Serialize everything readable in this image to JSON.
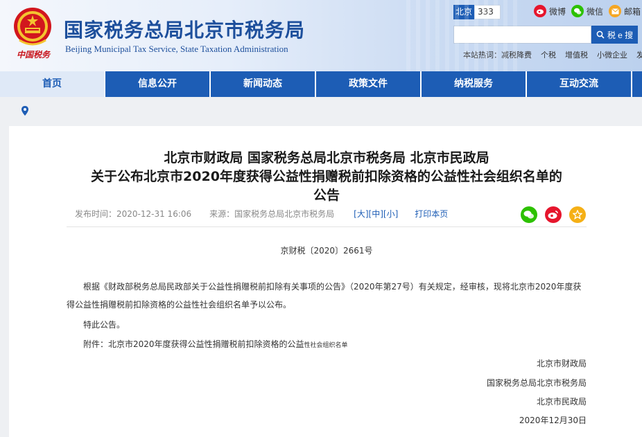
{
  "header": {
    "emblem_caption": "中国税务",
    "title": "国家税务总局北京市税务局",
    "subtitle": "Beijing Municipal Tax Service, State Taxation Administration",
    "city_label": "北京",
    "city_code": "333",
    "social": [
      {
        "label": "微博",
        "icon": "weibo-icon",
        "color": "#e6162d"
      },
      {
        "label": "微信",
        "icon": "wechat-icon",
        "color": "#2dc100"
      },
      {
        "label": "邮箱",
        "icon": "mail-icon",
        "color": "#f5a623"
      }
    ],
    "search_placeholder": "",
    "search_button": "税 e 搜",
    "hot_label": "本站热词：",
    "hot_words": [
      "减税降费",
      "个税",
      "增值税",
      "小微企业",
      "发票"
    ]
  },
  "nav": {
    "items": [
      "首页",
      "信息公开",
      "新闻动态",
      "政策文件",
      "纳税服务",
      "互动交流"
    ],
    "active_index": 0,
    "active_color": "#1d5db5"
  },
  "article": {
    "title_line1": "北京市财政局 国家税务总局北京市税务局 北京市民政局",
    "title_line2": "关于公布北京市2020年度获得公益性捐赠税前扣除资格的公益性社会组织名单的",
    "title_line3": "公告",
    "publish_label": "发布时间：2020-12-31 16:06",
    "source_label": "来源：国家税务总局北京市税务局",
    "font_sizes": [
      "[大]",
      "[中]",
      "[小]"
    ],
    "print_label": "打印本页",
    "doc_number": "京财税〔2020〕2661号",
    "paragraph1": "根据《财政部税务总局民政部关于公益性捐赠税前扣除有关事项的公告》（2020年第27号）有关规定，经审核，现将北京市2020年度获得公益性捐赠税前扣除资格的公益性社会组织名单予以公布。",
    "paragraph2": "特此公告。",
    "attachment_main": "附件：北京市2020年度获得公益性捐赠税前扣除资格的公益",
    "attachment_small": "性社会组织名单",
    "signatures": [
      "北京市财政局",
      "国家税务总局北京市税务局",
      "北京市民政局",
      "2020年12月30日"
    ]
  }
}
